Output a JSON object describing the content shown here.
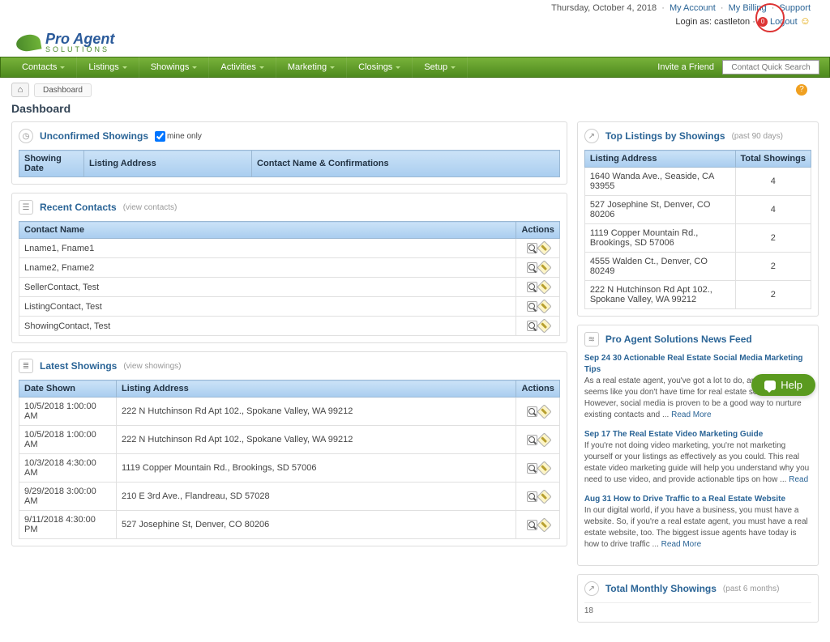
{
  "top": {
    "date": "Thursday, October 4, 2018",
    "links": [
      "My Account",
      "My Billing",
      "Support"
    ],
    "login_as": "Login as: castleton",
    "logout": "Logout"
  },
  "logo": {
    "line1": "Pro Agent",
    "line2": "SOLUTIONS"
  },
  "nav": {
    "items": [
      "Contacts",
      "Listings",
      "Showings",
      "Activities",
      "Marketing",
      "Closings",
      "Setup"
    ],
    "invite": "Invite a Friend",
    "search_placeholder": "Contact Quick Search"
  },
  "breadcrumb": {
    "item": "Dashboard"
  },
  "page_title": "Dashboard",
  "unconfirmed": {
    "title": "Unconfirmed Showings",
    "mine_label": "mine only",
    "cols": [
      "Showing Date",
      "Listing Address",
      "Contact Name & Confirmations"
    ]
  },
  "recent_contacts": {
    "title": "Recent Contacts",
    "sub": "(view contacts)",
    "col_name": "Contact Name",
    "col_actions": "Actions",
    "rows": [
      "Lname1, Fname1",
      "Lname2, Fname2",
      "SellerContact, Test",
      "ListingContact, Test",
      "ShowingContact, Test"
    ]
  },
  "latest_showings": {
    "title": "Latest Showings",
    "sub": "(view showings)",
    "col_date": "Date Shown",
    "col_addr": "Listing Address",
    "col_actions": "Actions",
    "rows": [
      {
        "d": "10/5/2018 1:00:00 AM",
        "a": "222 N Hutchinson Rd Apt 102., Spokane Valley, WA 99212"
      },
      {
        "d": "10/5/2018 1:00:00 AM",
        "a": "222 N Hutchinson Rd Apt 102., Spokane Valley, WA 99212"
      },
      {
        "d": "10/3/2018 4:30:00 AM",
        "a": "1119 Copper Mountain Rd., Brookings, SD 57006"
      },
      {
        "d": "9/29/2018 3:00:00 AM",
        "a": "210 E 3rd Ave., Flandreau, SD 57028"
      },
      {
        "d": "9/11/2018 4:30:00 PM",
        "a": "527 Josephine St, Denver, CO 80206"
      }
    ]
  },
  "top_listings": {
    "title": "Top Listings by Showings",
    "sub": "(past 90 days)",
    "col_addr": "Listing Address",
    "col_total": "Total Showings",
    "rows": [
      {
        "a": "1640 Wanda Ave., Seaside, CA 93955",
        "t": "4"
      },
      {
        "a": "527 Josephine St, Denver, CO 80206",
        "t": "4"
      },
      {
        "a": "1119 Copper Mountain Rd., Brookings, SD 57006",
        "t": "2"
      },
      {
        "a": "4555 Walden Ct., Denver, CO 80249",
        "t": "2"
      },
      {
        "a": "222 N Hutchinson Rd Apt 102., Spokane Valley, WA 99212",
        "t": "2"
      }
    ]
  },
  "news": {
    "title": "Pro Agent Solutions News Feed",
    "items": [
      {
        "t": "Sep 24 30 Actionable Real Estate Social Media Marketing Tips",
        "b": "As a real estate agent, you've got a lot to do, and sometimes it seems like you don't have time for real estate social media. However, social media is proven to be a good way to nurture existing contacts and ... ",
        "m": "Read More"
      },
      {
        "t": "Sep 17 The Real Estate Video Marketing Guide",
        "b": "If you're not doing video marketing, you're not marketing yourself or your listings as effectively as you could. This real estate video marketing guide will help you understand why you need to use video, and provide actionable tips on how ... ",
        "m": "Read"
      },
      {
        "t": "Aug 31 How to Drive Traffic to a Real Estate Website",
        "b": "In our digital world, if you have a business, you must have a website. So, if you're a real estate agent, you must have a real estate website, too. The biggest issue agents have today is how to drive traffic ... ",
        "m": "Read More"
      }
    ]
  },
  "monthly": {
    "title": "Total Monthly Showings",
    "sub": "(past 6 months)",
    "tick": "18"
  },
  "help": {
    "label": "Help"
  },
  "chart_data": {
    "type": "bar",
    "title": "Total Monthly Showings (past 6 months)",
    "categories": [],
    "values": [],
    "ylim": [
      0,
      18
    ]
  }
}
